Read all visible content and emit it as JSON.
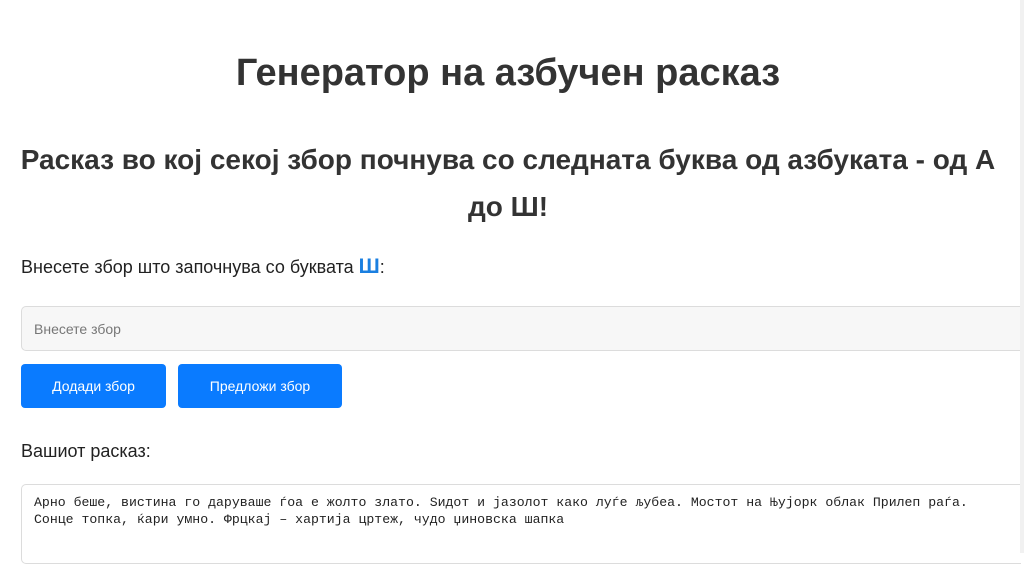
{
  "header": {
    "title": "Генератор на азбучен расказ",
    "subtitle": "Расказ во кој секој збор почнува со следната буква од азбуката - од А до Ш!"
  },
  "prompt": {
    "text_before": "Внесете збор што започнува со буквата ",
    "letter": "Ш",
    "text_after": ":",
    "letter_color": "#1a7fe0"
  },
  "word_input": {
    "placeholder": "Внесете збор",
    "value": ""
  },
  "buttons": {
    "add_label": "Додади збор",
    "suggest_label": "Предложи збор",
    "color": "#0a7bff"
  },
  "story": {
    "label": "Вашиот расказ:",
    "text": "Арно беше, вистина го даруваше ѓоа е жолто злато. Ѕидот и јазолот како луѓе љубеа. Мостот на Њујорк облак Прилеп раѓа. Сонце топка, ќари умно. Фрцкај – хартија цртеж, чудо џиновска шапка"
  }
}
